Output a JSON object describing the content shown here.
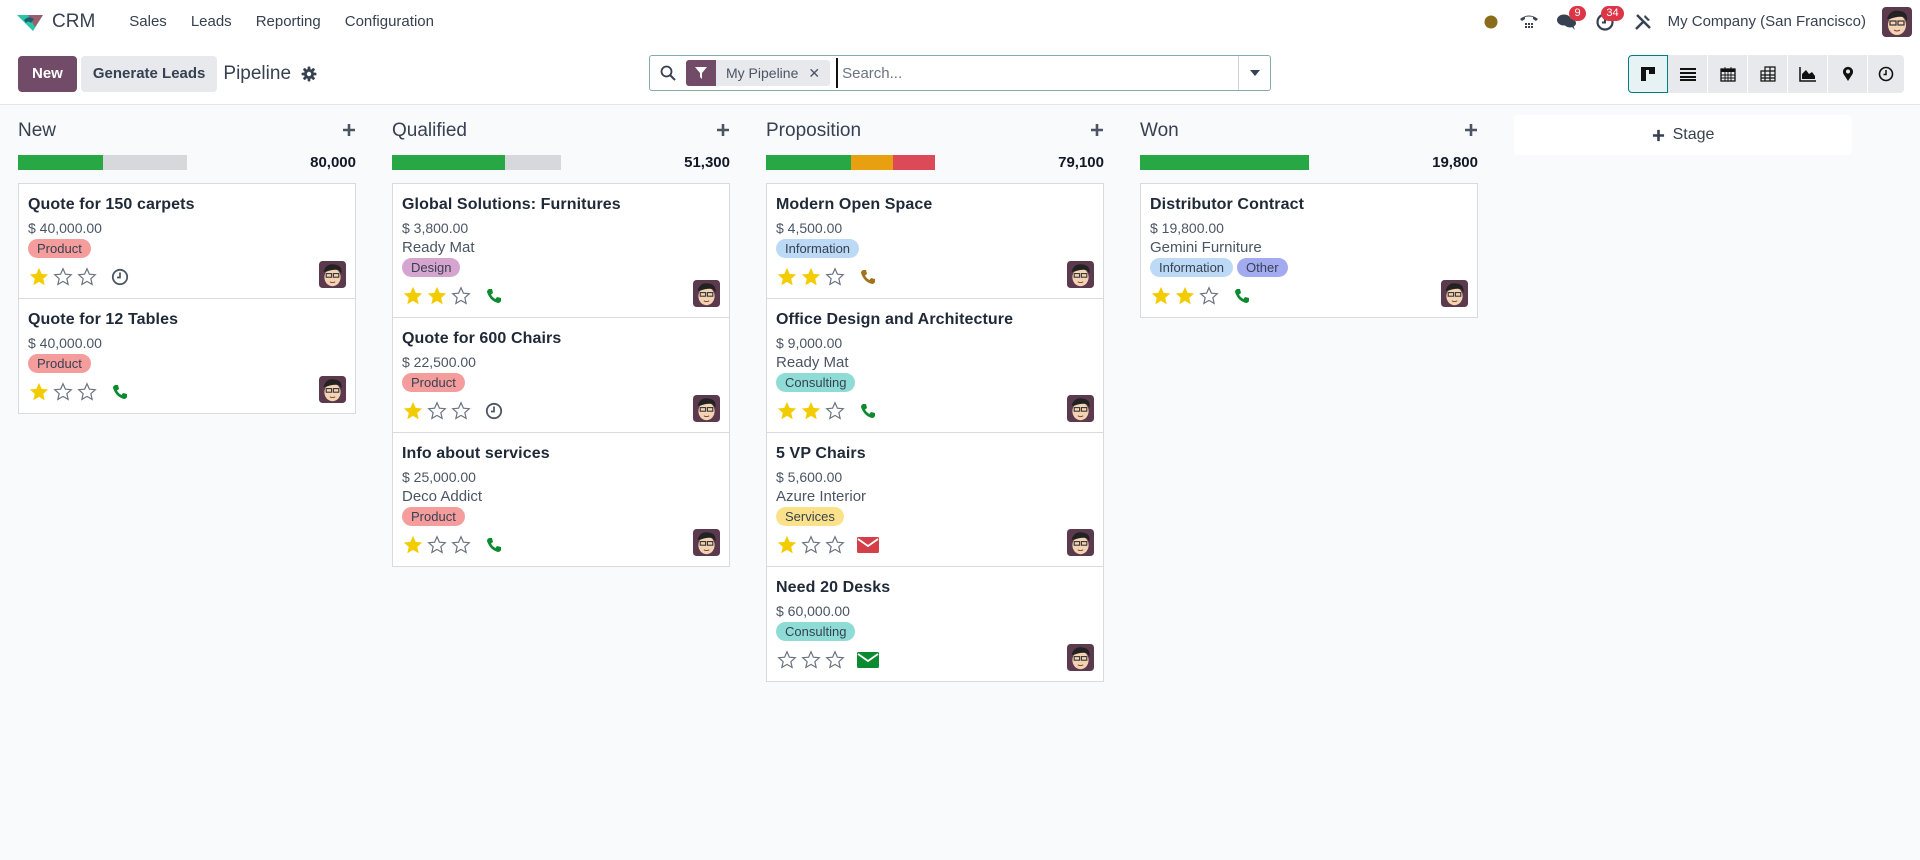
{
  "navbar": {
    "app_name": "CRM",
    "menu": [
      "Sales",
      "Leads",
      "Reporting",
      "Configuration"
    ],
    "status_color": "#8a6d1a",
    "messages_count": "9",
    "activities_count": "34",
    "company": "My Company (San Francisco)"
  },
  "control_panel": {
    "new_label": "New",
    "generate_label": "Generate Leads",
    "title": "Pipeline",
    "search": {
      "facet_label": "My Pipeline",
      "placeholder": "Search..."
    },
    "views": [
      "kanban",
      "list",
      "calendar",
      "pivot",
      "graph",
      "map",
      "activity"
    ],
    "active_view": "kanban"
  },
  "colors": {
    "primary": "#714b67",
    "accent": "#017e84",
    "progress_green": "#28a745",
    "progress_orange": "#e8a010",
    "progress_red": "#dc4a5a",
    "progress_empty": "#d6d8dc",
    "star_filled": "#f3cc00",
    "phone_green": "#0b8a2f",
    "phone_brown": "#a0731c",
    "mail_red": "#d43f4a",
    "mail_green": "#0b8a2f"
  },
  "tag_colors": {
    "Product": "#f59c9c",
    "Design": "#d6a5cf",
    "Information": "#bcd9f5",
    "Consulting": "#8fdcd6",
    "Services": "#fbe28a",
    "Other": "#a3abf0"
  },
  "stages": [
    {
      "name": "New",
      "total": "80,000",
      "progress": {
        "green": 0.5,
        "orange": 0,
        "red": 0
      },
      "cards": [
        {
          "title": "Quote for 150 carpets",
          "amount": "$ 40,000.00",
          "partner": "",
          "tags": [
            "Product"
          ],
          "stars": 1,
          "activity": "clock"
        },
        {
          "title": "Quote for 12 Tables",
          "amount": "$ 40,000.00",
          "partner": "",
          "tags": [
            "Product"
          ],
          "stars": 1,
          "activity": "phone-green"
        }
      ]
    },
    {
      "name": "Qualified",
      "total": "51,300",
      "progress": {
        "green": 0.67,
        "orange": 0,
        "red": 0
      },
      "cards": [
        {
          "title": "Global Solutions: Furnitures",
          "amount": "$ 3,800.00",
          "partner": "Ready Mat",
          "tags": [
            "Design"
          ],
          "stars": 2,
          "activity": "phone-green"
        },
        {
          "title": "Quote for 600 Chairs",
          "amount": "$ 22,500.00",
          "partner": "",
          "tags": [
            "Product"
          ],
          "stars": 1,
          "activity": "clock"
        },
        {
          "title": "Info about services",
          "amount": "$ 25,000.00",
          "partner": "Deco Addict",
          "tags": [
            "Product"
          ],
          "stars": 1,
          "activity": "phone-green"
        }
      ]
    },
    {
      "name": "Proposition",
      "total": "79,100",
      "progress": {
        "green": 0.5,
        "orange": 0.25,
        "red": 0.25
      },
      "cards": [
        {
          "title": "Modern Open Space",
          "amount": "$ 4,500.00",
          "partner": "",
          "tags": [
            "Information"
          ],
          "stars": 2,
          "activity": "phone-brown"
        },
        {
          "title": "Office Design and Architecture",
          "amount": "$ 9,000.00",
          "partner": "Ready Mat",
          "tags": [
            "Consulting"
          ],
          "stars": 2,
          "activity": "phone-green"
        },
        {
          "title": "5 VP Chairs",
          "amount": "$ 5,600.00",
          "partner": "Azure Interior",
          "tags": [
            "Services"
          ],
          "stars": 1,
          "activity": "mail-red"
        },
        {
          "title": "Need 20 Desks",
          "amount": "$ 60,000.00",
          "partner": "",
          "tags": [
            "Consulting"
          ],
          "stars": 0,
          "activity": "mail-green"
        }
      ]
    },
    {
      "name": "Won",
      "total": "19,800",
      "progress": {
        "green": 1,
        "orange": 0,
        "red": 0
      },
      "cards": [
        {
          "title": "Distributor Contract",
          "amount": "$ 19,800.00",
          "partner": "Gemini Furniture",
          "tags": [
            "Information",
            "Other"
          ],
          "stars": 2,
          "activity": "phone-green"
        }
      ]
    }
  ],
  "add_stage_label": "Stage"
}
